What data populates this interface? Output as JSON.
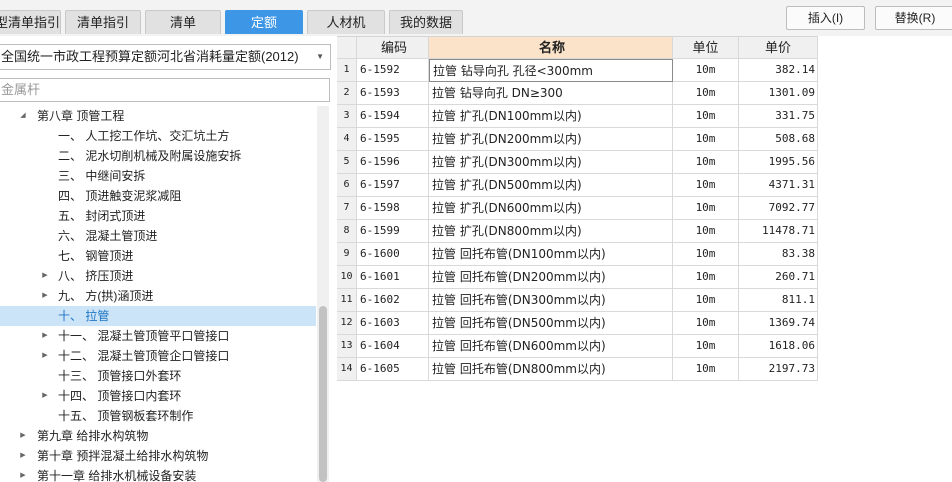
{
  "tabs": [
    {
      "label": "型清单指引",
      "active": false
    },
    {
      "label": "清单指引",
      "active": false
    },
    {
      "label": "清单",
      "active": false
    },
    {
      "label": "定额",
      "active": true
    },
    {
      "label": "人材机",
      "active": false
    },
    {
      "label": "我的数据",
      "active": false
    }
  ],
  "toolbar": {
    "insert_label": "插入(I)",
    "replace_label": "替换(R)"
  },
  "library": {
    "selected": "全国统一市政工程预算定额河北省消耗量定额(2012)"
  },
  "search": {
    "value": "金属杆"
  },
  "tree": [
    {
      "label": "第八章 顶管工程",
      "expander": "expanded"
    },
    {
      "label": "一、 人工挖工作坑、交汇坑土方",
      "expander": ""
    },
    {
      "label": "二、 泥水切削机械及附属设施安拆",
      "expander": ""
    },
    {
      "label": "三、 中继间安拆",
      "expander": ""
    },
    {
      "label": "四、 顶进触变泥浆减阻",
      "expander": ""
    },
    {
      "label": "五、 封闭式顶进",
      "expander": ""
    },
    {
      "label": "六、 混凝土管顶进",
      "expander": ""
    },
    {
      "label": "七、 钢管顶进",
      "expander": ""
    },
    {
      "label": "八、 挤压顶进",
      "expander": "collapsed"
    },
    {
      "label": "九、 方(拱)涵顶进",
      "expander": "collapsed"
    },
    {
      "label": "十、 拉管",
      "expander": "",
      "selected": true
    },
    {
      "label": "十一、 混凝土管顶管平口管接口",
      "expander": "collapsed"
    },
    {
      "label": "十二、 混凝土管顶管企口管接口",
      "expander": "collapsed"
    },
    {
      "label": "十三、 顶管接口外套环",
      "expander": ""
    },
    {
      "label": "十四、 顶管接口内套环",
      "expander": "collapsed"
    },
    {
      "label": "十五、 顶管钢板套环制作",
      "expander": ""
    },
    {
      "label": "第九章 给排水构筑物",
      "expander": "collapsed"
    },
    {
      "label": "第十章 预拌混凝土给排水构筑物",
      "expander": "collapsed"
    },
    {
      "label": "第十一章 给排水机械设备安装",
      "expander": "collapsed"
    }
  ],
  "table": {
    "headers": [
      "编码",
      "名称",
      "单位",
      "单价"
    ],
    "rows": [
      {
        "no": "1",
        "code": "6-1592",
        "name": "拉管 钻导向孔 孔径<300mm",
        "unit": "10m",
        "price": "382.14"
      },
      {
        "no": "2",
        "code": "6-1593",
        "name": "拉管 钻导向孔 DN≥300",
        "unit": "10m",
        "price": "1301.09"
      },
      {
        "no": "3",
        "code": "6-1594",
        "name": "拉管 扩孔(DN100mm以内)",
        "unit": "10m",
        "price": "331.75"
      },
      {
        "no": "4",
        "code": "6-1595",
        "name": "拉管 扩孔(DN200mm以内)",
        "unit": "10m",
        "price": "508.68"
      },
      {
        "no": "5",
        "code": "6-1596",
        "name": "拉管 扩孔(DN300mm以内)",
        "unit": "10m",
        "price": "1995.56"
      },
      {
        "no": "6",
        "code": "6-1597",
        "name": "拉管 扩孔(DN500mm以内)",
        "unit": "10m",
        "price": "4371.31"
      },
      {
        "no": "7",
        "code": "6-1598",
        "name": "拉管 扩孔(DN600mm以内)",
        "unit": "10m",
        "price": "7092.77"
      },
      {
        "no": "8",
        "code": "6-1599",
        "name": "拉管 扩孔(DN800mm以内)",
        "unit": "10m",
        "price": "11478.71"
      },
      {
        "no": "9",
        "code": "6-1600",
        "name": "拉管 回托布管(DN100mm以内)",
        "unit": "10m",
        "price": "83.38"
      },
      {
        "no": "10",
        "code": "6-1601",
        "name": "拉管 回托布管(DN200mm以内)",
        "unit": "10m",
        "price": "260.71"
      },
      {
        "no": "11",
        "code": "6-1602",
        "name": "拉管 回托布管(DN300mm以内)",
        "unit": "10m",
        "price": "811.1"
      },
      {
        "no": "12",
        "code": "6-1603",
        "name": "拉管 回托布管(DN500mm以内)",
        "unit": "10m",
        "price": "1369.74"
      },
      {
        "no": "13",
        "code": "6-1604",
        "name": "拉管 回托布管(DN600mm以内)",
        "unit": "10m",
        "price": "1618.06"
      },
      {
        "no": "14",
        "code": "6-1605",
        "name": "拉管 回托布管(DN800mm以内)",
        "unit": "10m",
        "price": "2197.73"
      }
    ]
  },
  "colors": {
    "accent": "#3d97e6",
    "selected_bg": "#cce4f7",
    "header_highlight": "#fbe3c9"
  }
}
